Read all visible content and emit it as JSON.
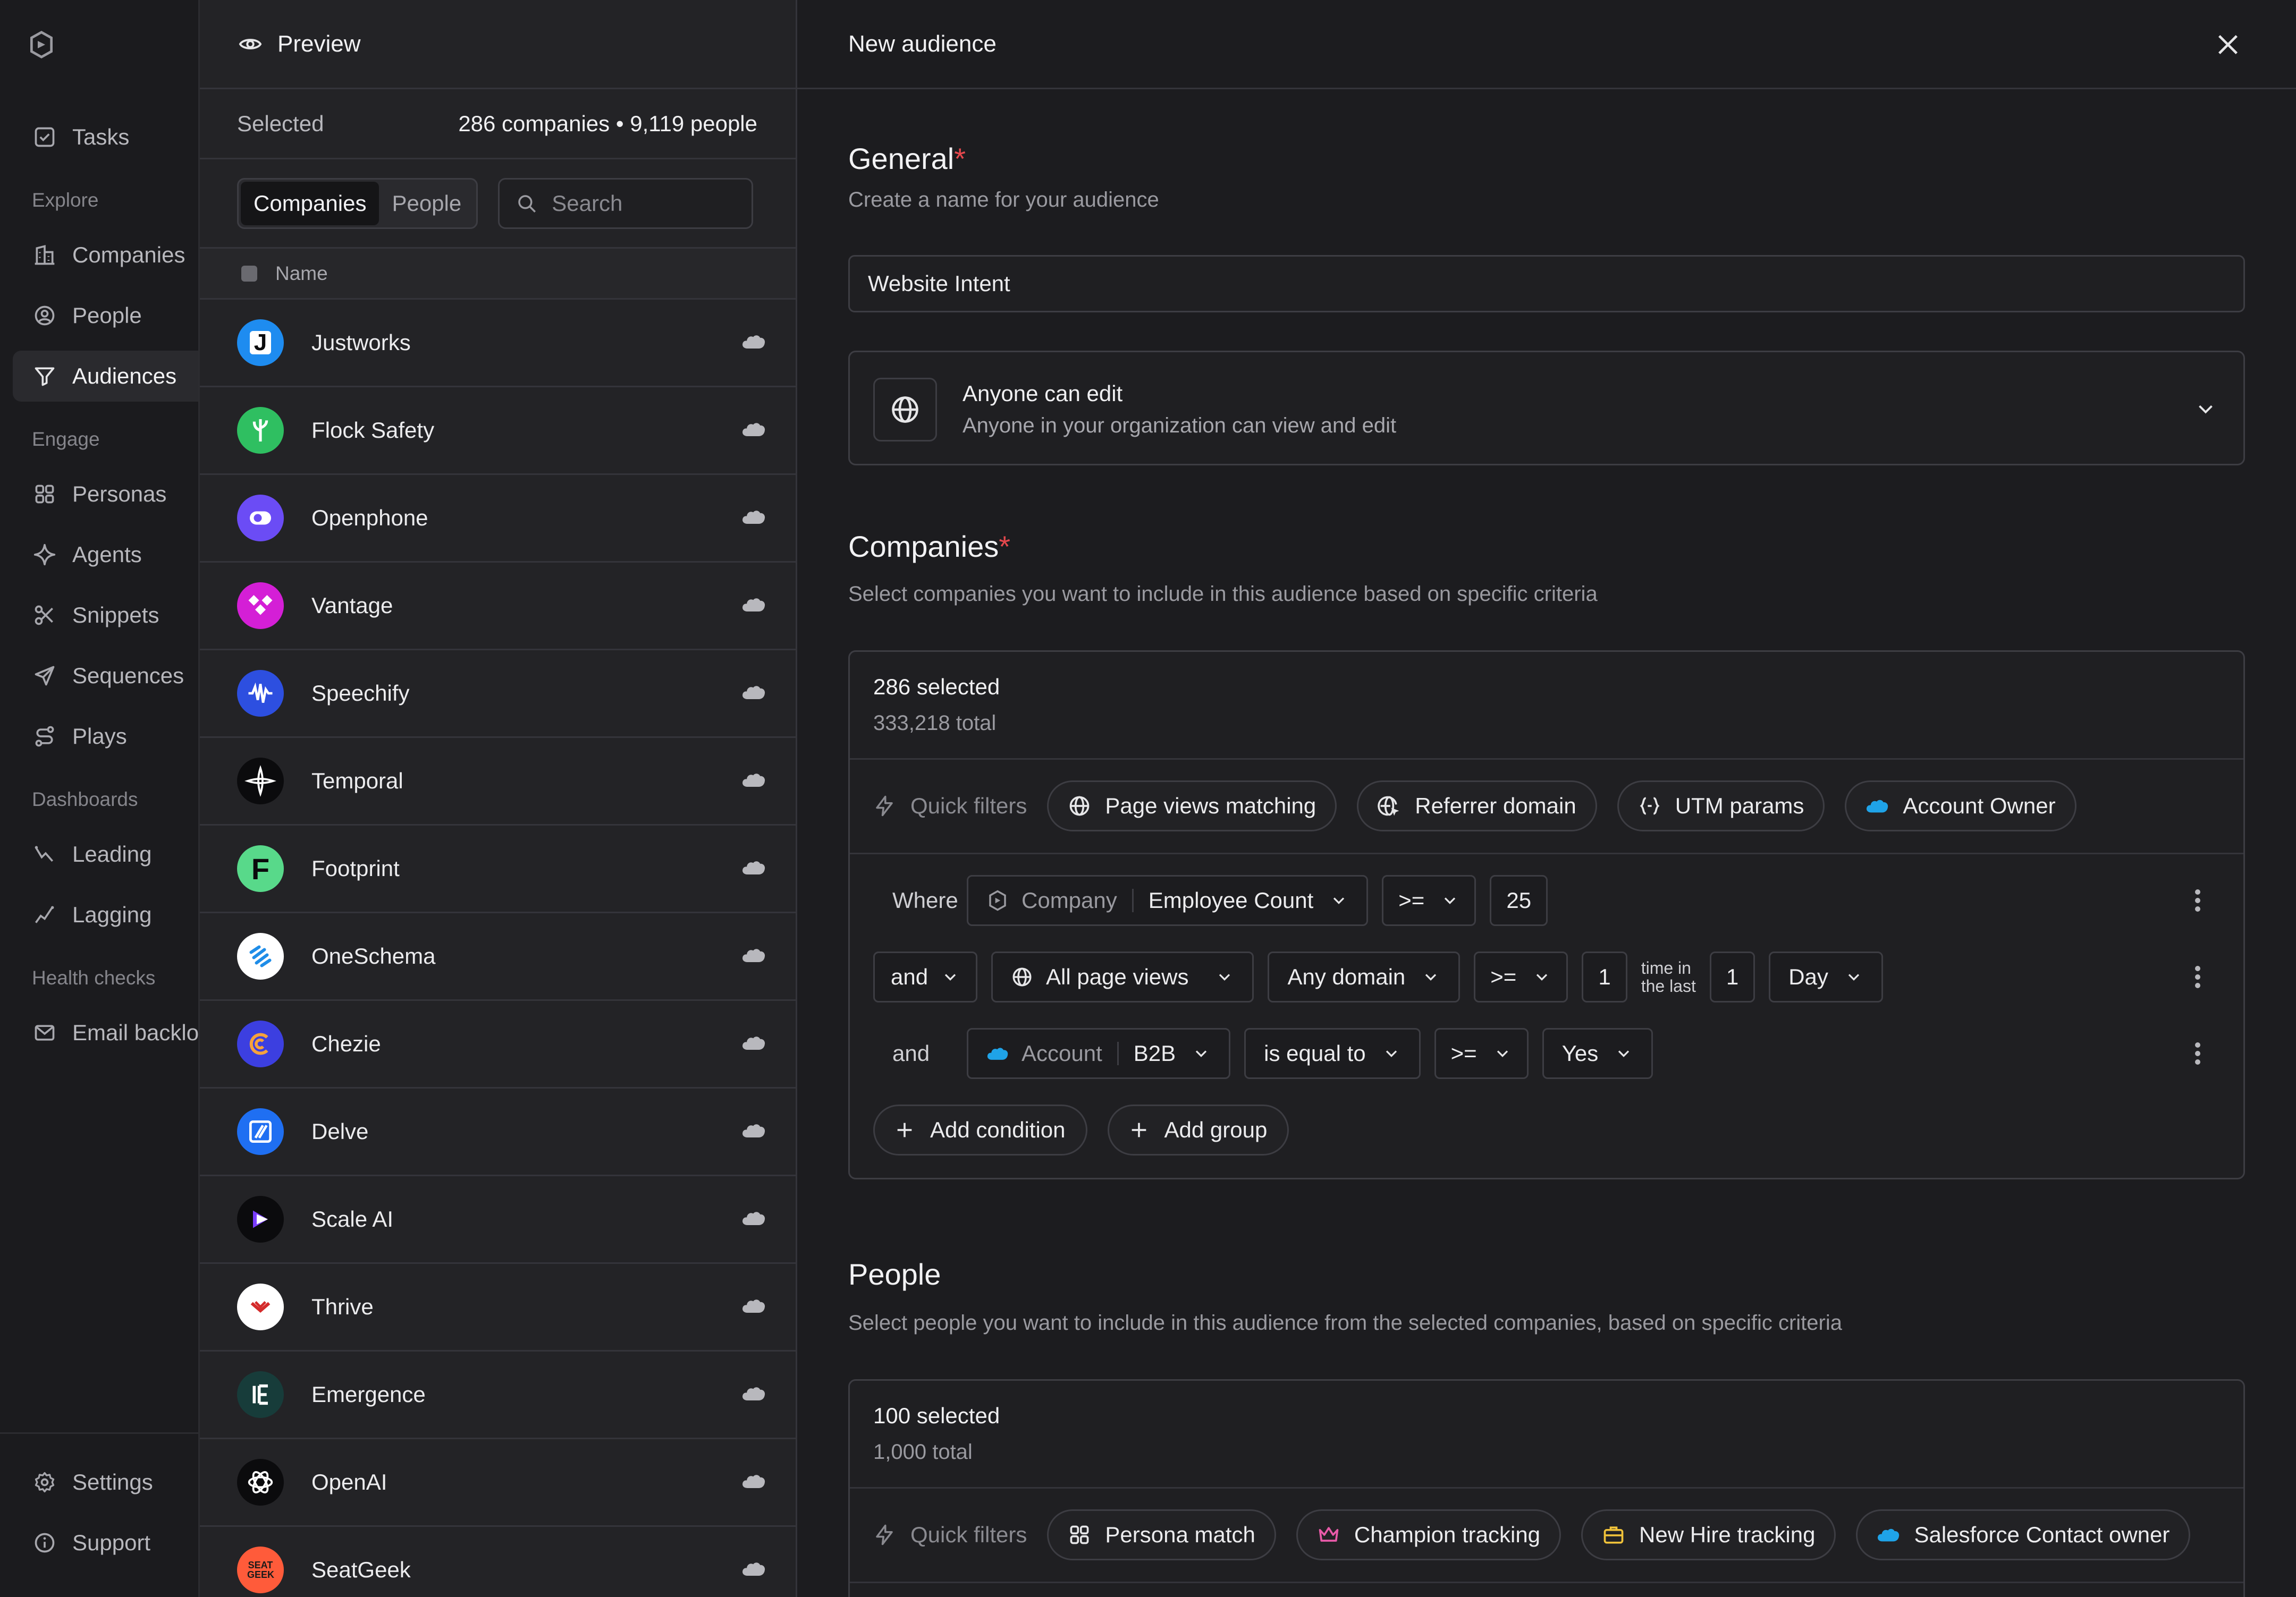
{
  "nav": {
    "items": [
      {
        "key": "tasks",
        "label": "Tasks",
        "icon": "checkbox-icon"
      },
      {
        "key": "companies",
        "label": "Companies",
        "icon": "building-icon"
      },
      {
        "key": "people",
        "label": "People",
        "icon": "user-circle-icon"
      },
      {
        "key": "audiences",
        "label": "Audiences",
        "icon": "filter-icon",
        "active": true
      },
      {
        "key": "personas",
        "label": "Personas",
        "icon": "grid-icon"
      },
      {
        "key": "agents",
        "label": "Agents",
        "icon": "sparkle-icon"
      },
      {
        "key": "snippets",
        "label": "Snippets",
        "icon": "scissors-icon"
      },
      {
        "key": "sequences",
        "label": "Sequences",
        "icon": "send-icon"
      },
      {
        "key": "plays",
        "label": "Plays",
        "icon": "route-icon"
      },
      {
        "key": "leading",
        "label": "Leading",
        "icon": "chart-up-icon"
      },
      {
        "key": "lagging",
        "label": "Lagging",
        "icon": "chart-down-icon"
      },
      {
        "key": "email_backlog",
        "label": "Email backlog",
        "icon": "mail-icon"
      },
      {
        "key": "settings",
        "label": "Settings",
        "icon": "gear-icon"
      },
      {
        "key": "support",
        "label": "Support",
        "icon": "info-icon"
      }
    ],
    "sections": {
      "explore": "Explore",
      "engage": "Engage",
      "dashboards": "Dashboards",
      "health": "Health checks"
    }
  },
  "preview": {
    "title": "Preview",
    "selected_label": "Selected",
    "selected_value": "286 companies • 9,119 people",
    "tabs": [
      "Companies",
      "People"
    ],
    "search_placeholder": "Search",
    "column_name": "Name",
    "companies": [
      {
        "name": "Justworks",
        "color": "#1e8cf0",
        "glyph": "J"
      },
      {
        "name": "Flock Safety",
        "color": "#2fbf61",
        "glyph": ""
      },
      {
        "name": "Openphone",
        "color": "#6b4cf5",
        "glyph": ""
      },
      {
        "name": "Vantage",
        "color": "#d41fd6",
        "glyph": ""
      },
      {
        "name": "Speechify",
        "color": "#2d4fe0",
        "glyph": ""
      },
      {
        "name": "Temporal",
        "color": "#0b0b0d",
        "glyph": ""
      },
      {
        "name": "Footprint",
        "color": "#58d98a",
        "glyph": "F"
      },
      {
        "name": "OneSchema",
        "color": "#ffffff",
        "glyph": ""
      },
      {
        "name": "Chezie",
        "color": "#3c3fe0",
        "glyph": ""
      },
      {
        "name": "Delve",
        "color": "#1f6ff2",
        "glyph": ""
      },
      {
        "name": "Scale AI",
        "color": "#0b0b0d",
        "glyph": ""
      },
      {
        "name": "Thrive",
        "color": "#ffffff",
        "glyph": ""
      },
      {
        "name": "Emergence",
        "color": "#173c3a",
        "glyph": ""
      },
      {
        "name": "OpenAI",
        "color": "#0b0b0d",
        "glyph": ""
      },
      {
        "name": "SeatGeek",
        "color": "#ff5b3a",
        "glyph": "SEAT GEEK"
      }
    ]
  },
  "main": {
    "title": "New audience",
    "general": {
      "title": "General",
      "required": "*",
      "subtitle": "Create a name for your audience",
      "name_value": "Website Intent",
      "permission_title": "Anyone can edit",
      "permission_desc": "Anyone in your organization can view and edit"
    },
    "companies": {
      "title": "Companies",
      "required": "*",
      "subtitle": "Select companies you want to include in this audience based on specific criteria",
      "selected": "286 selected",
      "total": "333,218 total",
      "quick_filters_label": "Quick filters",
      "quick_filters": [
        {
          "label": "Page views matching",
          "icon": "globe-icon"
        },
        {
          "label": "Referrer domain",
          "icon": "globe-cursor-icon"
        },
        {
          "label": "UTM params",
          "icon": "braces-icon"
        },
        {
          "label": "Account Owner",
          "icon": "salesforce-icon"
        }
      ],
      "conditions": {
        "row1": {
          "lead": "Where",
          "entity": "Company",
          "field": "Employee Count",
          "op": ">=",
          "value": "25"
        },
        "row2": {
          "lead": "and",
          "metric": "All page views",
          "domain": "Any domain",
          "op": ">=",
          "count": "1",
          "time_label_1": "time in",
          "time_label_2": "the last",
          "period_count": "1",
          "period": "Day"
        },
        "row3": {
          "lead": "and",
          "entity": "Account",
          "field": "B2B",
          "op": "is equal to",
          "op2": ">=",
          "value": "Yes"
        }
      },
      "add_condition": "Add condition",
      "add_group": "Add group"
    },
    "people": {
      "title": "People",
      "subtitle": "Select people you want to include in this audience from the selected companies, based on specific criteria",
      "selected": "100 selected",
      "total": "1,000 total",
      "quick_filters_label": "Quick filters",
      "quick_filters": [
        {
          "label": "Persona match",
          "icon": "grid-icon"
        },
        {
          "label": "Champion tracking",
          "icon": "crown-icon"
        },
        {
          "label": "New Hire tracking",
          "icon": "briefcase-icon"
        },
        {
          "label": "Salesforce Contact owner",
          "icon": "salesforce-icon"
        }
      ]
    }
  },
  "colors": {
    "accent_required": "#e5484d",
    "salesforce": "#1fa3e8",
    "crown": "#e85aa8",
    "briefcase": "#f0c23a"
  }
}
